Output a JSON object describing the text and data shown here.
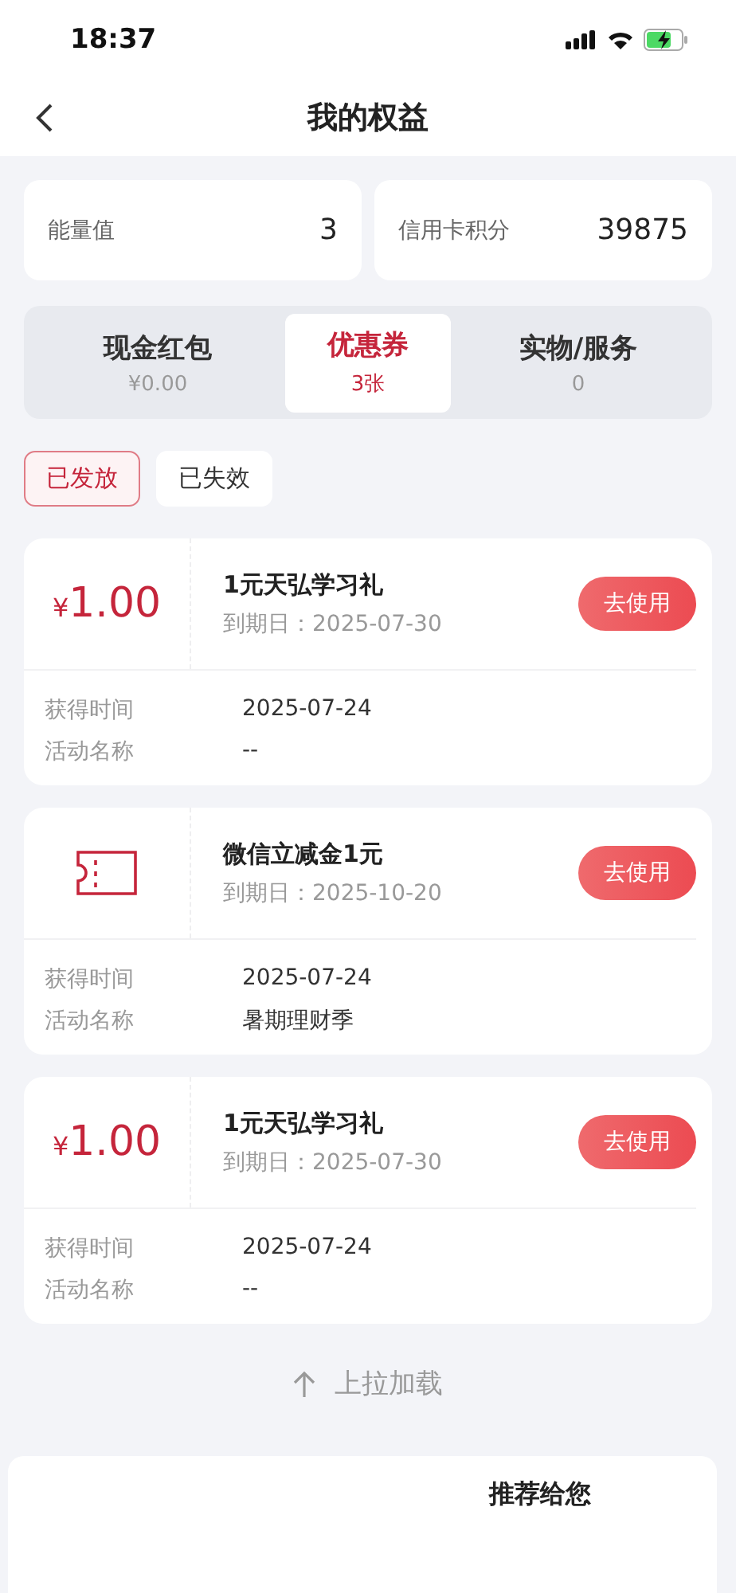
{
  "status_bar": {
    "time": "18:37"
  },
  "nav": {
    "title": "我的权益"
  },
  "stats": [
    {
      "label": "能量值",
      "value": "3"
    },
    {
      "label": "信用卡积分",
      "value": "39875"
    }
  ],
  "categories": [
    {
      "label": "现金红包",
      "sub": "¥0.00",
      "selected": false
    },
    {
      "label": "优惠券",
      "sub": "3张",
      "selected": true
    },
    {
      "label": "实物/服务",
      "sub": "0",
      "selected": false
    }
  ],
  "filters": [
    {
      "label": "已发放",
      "selected": true
    },
    {
      "label": "已失效",
      "selected": false
    }
  ],
  "coupons": [
    {
      "kind": "amount",
      "currency": "¥",
      "amount": "1.00",
      "title": "1元天弘学习礼",
      "expiry": "到期日：2025-07-30",
      "button": "去使用",
      "obtained_label": "获得时间",
      "obtained": "2025-07-24",
      "activity_label": "活动名称",
      "activity": "--"
    },
    {
      "kind": "ticket",
      "title": "微信立减金1元",
      "expiry": "到期日：2025-10-20",
      "button": "去使用",
      "obtained_label": "获得时间",
      "obtained": "2025-07-24",
      "activity_label": "活动名称",
      "activity": "暑期理财季"
    },
    {
      "kind": "amount",
      "currency": "¥",
      "amount": "1.00",
      "title": "1元天弘学习礼",
      "expiry": "到期日：2025-07-30",
      "button": "去使用",
      "obtained_label": "获得时间",
      "obtained": "2025-07-24",
      "activity_label": "活动名称",
      "activity": "--"
    }
  ],
  "load_more": "上拉加载",
  "recommend": {
    "title": "推荐给您"
  }
}
